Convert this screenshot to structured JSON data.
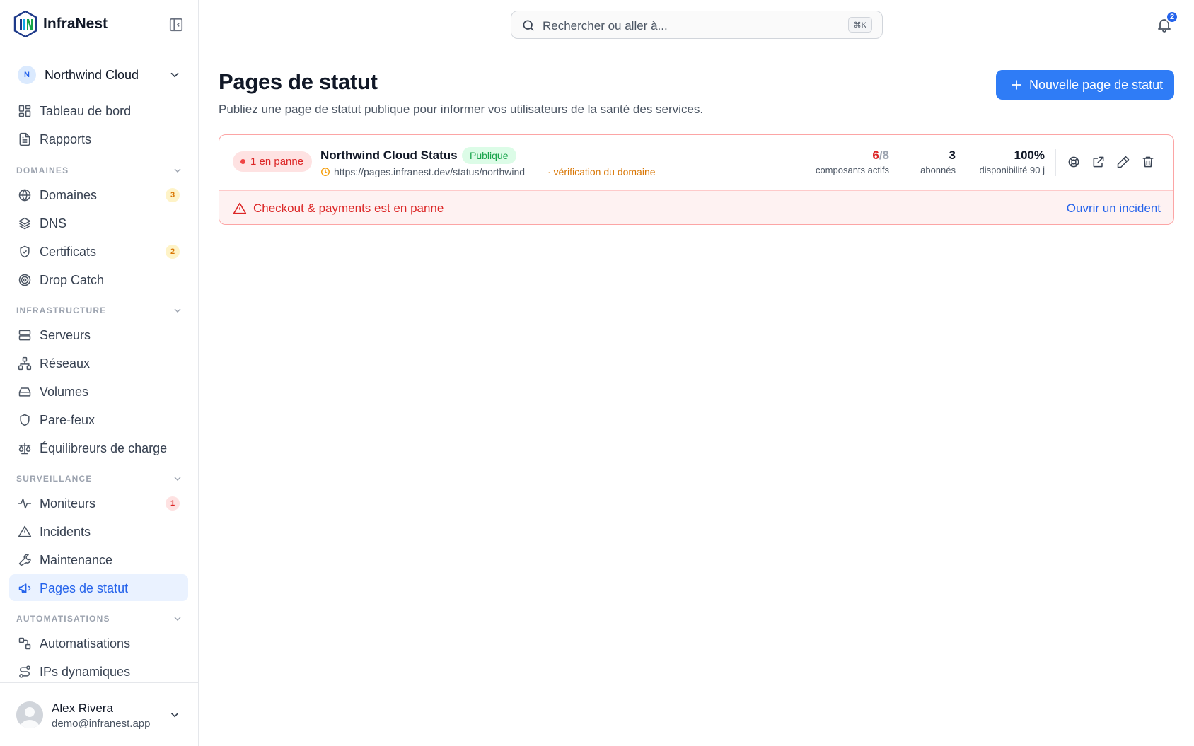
{
  "brand": {
    "name": "InfraNest"
  },
  "org": {
    "initial": "N",
    "name": "Northwind Cloud"
  },
  "nav_top": [
    {
      "label": "Tableau de bord",
      "icon": "dashboard-icon"
    },
    {
      "label": "Rapports",
      "icon": "report-icon"
    }
  ],
  "sections": {
    "domaines": "DOMAINES",
    "infrastructure": "INFRASTRUCTURE",
    "surveillance": "SURVEILLANCE",
    "automatisations": "AUTOMATISATIONS"
  },
  "nav_domaines": [
    {
      "label": "Domaines",
      "icon": "globe-icon",
      "count": "3"
    },
    {
      "label": "DNS",
      "icon": "layers-icon"
    },
    {
      "label": "Certificats",
      "icon": "shield-check-icon",
      "count": "2"
    },
    {
      "label": "Drop Catch",
      "icon": "target-icon"
    }
  ],
  "nav_infrastructure": [
    {
      "label": "Serveurs",
      "icon": "server-icon"
    },
    {
      "label": "Réseaux",
      "icon": "network-icon"
    },
    {
      "label": "Volumes",
      "icon": "hard-drive-icon"
    },
    {
      "label": "Pare-feux",
      "icon": "shield-icon"
    },
    {
      "label": "Équilibreurs de charge",
      "icon": "scale-icon"
    }
  ],
  "nav_surveillance": [
    {
      "label": "Moniteurs",
      "icon": "activity-icon",
      "count": "1"
    },
    {
      "label": "Incidents",
      "icon": "alert-triangle-icon"
    },
    {
      "label": "Maintenance",
      "icon": "wrench-icon"
    },
    {
      "label": "Pages de statut",
      "icon": "megaphone-icon",
      "active": true
    }
  ],
  "nav_automatisations": [
    {
      "label": "Automatisations",
      "icon": "workflow-icon"
    },
    {
      "label": "IPs dynamiques",
      "icon": "route-icon"
    }
  ],
  "user": {
    "name": "Alex Rivera",
    "email": "demo@infranest.app"
  },
  "search": {
    "placeholder": "Rechercher ou aller à...",
    "shortcut": "⌘K"
  },
  "notifications": {
    "count": "2"
  },
  "page": {
    "title": "Pages de statut",
    "subtitle": "Publiez une page de statut publique pour informer vos utilisateurs de la santé des services.",
    "new_button": "Nouvelle page de statut"
  },
  "status_page": {
    "down_label": "1 en panne",
    "name": "Northwind Cloud Status",
    "visibility": "Publique",
    "url": "https://pages.infranest.dev/status/northwind",
    "verification": "· vérification du domaine",
    "active_components": "6",
    "total_components": "/8",
    "components_caption": "composants actifs",
    "subscribers": "3",
    "subscribers_caption": "abonnés",
    "uptime": "100%",
    "uptime_caption": "disponibilité 90 j",
    "alert": "Checkout & payments est en panne",
    "alert_action": "Ouvrir un incident"
  },
  "colors": {
    "accent": "#2f7cf6",
    "danger": "#dc2626",
    "success": "#22c55e",
    "warning": "#d97706"
  }
}
